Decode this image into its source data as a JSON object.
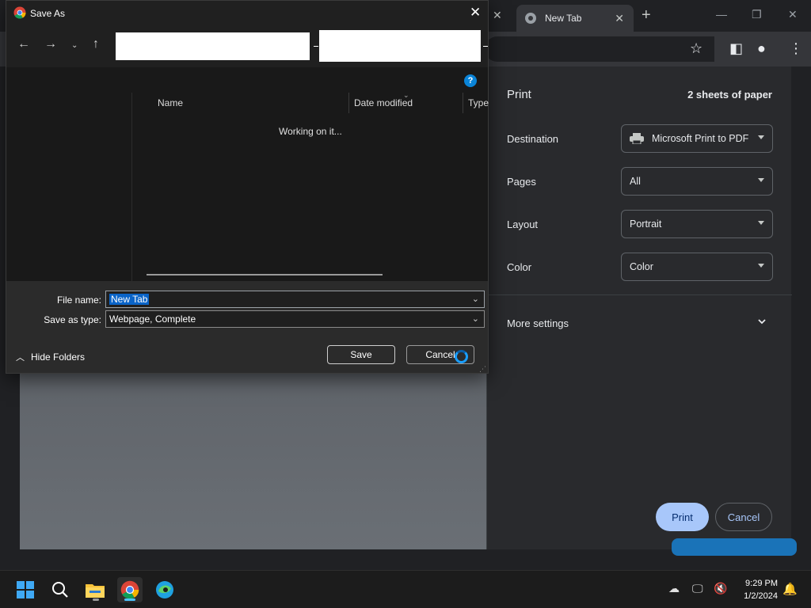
{
  "chrome": {
    "tab_title": "New Tab"
  },
  "print": {
    "title": "Print",
    "sheets": "2 sheets of paper",
    "rows": [
      {
        "label": "Destination",
        "value": "Microsoft Print to PDF"
      },
      {
        "label": "Pages",
        "value": "All"
      },
      {
        "label": "Layout",
        "value": "Portrait"
      },
      {
        "label": "Color",
        "value": "Color"
      }
    ],
    "more_settings": "More settings",
    "print_button": "Print",
    "cancel_button": "Cancel",
    "accent": "#a8c7fa"
  },
  "dialog": {
    "title": "Save As",
    "columns": [
      "Name",
      "Date modified",
      "Type"
    ],
    "status": "Working on it...",
    "file_name_label": "File name:",
    "file_name_value": "New Tab",
    "save_type_label": "Save as type:",
    "save_type_value": "Webpage, Complete",
    "hide_folders": "Hide Folders",
    "save_button": "Save",
    "cancel_button": "Cancel",
    "help": "?"
  },
  "taskbar": {
    "time": "9:29 PM",
    "date": "1/2/2024",
    "apps": [
      "start-icon",
      "search-icon",
      "file-explorer-icon",
      "chrome-icon",
      "edge-icon"
    ]
  }
}
